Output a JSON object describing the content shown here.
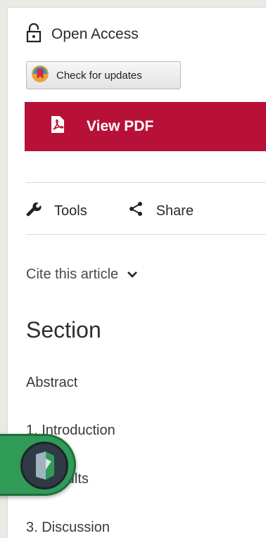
{
  "access": {
    "label": "Open Access",
    "icon": "unlocked-padlock-icon"
  },
  "updates_button": {
    "label": "Check for updates",
    "icon": "crossmark-icon"
  },
  "pdf_button": {
    "label": "View PDF",
    "icon": "pdf-file-icon",
    "color": "#b81138"
  },
  "tools": [
    {
      "label": "Tools",
      "icon": "wrench-icon"
    },
    {
      "label": "Share",
      "icon": "share-icon"
    }
  ],
  "cite": {
    "label": "Cite this article",
    "icon": "chevron-down-icon"
  },
  "section": {
    "title": "Section",
    "items": [
      "Abstract",
      "1. Introduction",
      "2. Results",
      "3. Discussion"
    ]
  },
  "badge": {
    "icon": "bookmark-logo-icon",
    "color": "#2f9b57"
  }
}
